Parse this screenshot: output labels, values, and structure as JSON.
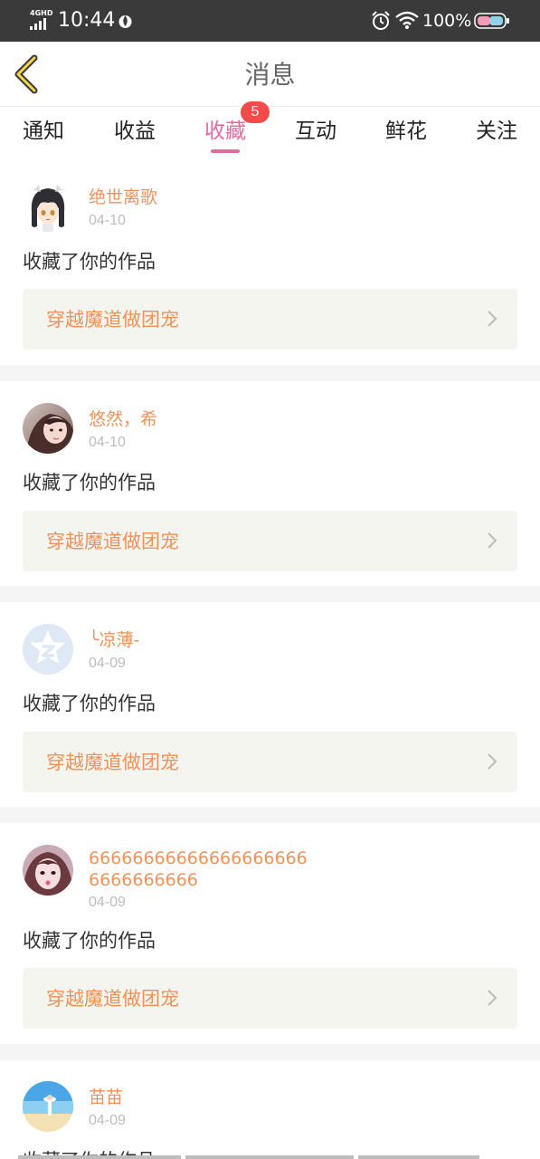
{
  "status_bar": {
    "network": "4GHD",
    "time": "10:44",
    "battery": "100%"
  },
  "header": {
    "title": "消息"
  },
  "tabs": [
    {
      "label": "通知",
      "active": false
    },
    {
      "label": "收益",
      "active": false
    },
    {
      "label": "收藏",
      "active": true,
      "badge": "5"
    },
    {
      "label": "互动",
      "active": false
    },
    {
      "label": "鲜花",
      "active": false
    },
    {
      "label": "关注",
      "active": false
    }
  ],
  "messages": [
    {
      "user": "绝世离歌",
      "date": "04-10",
      "action": "收藏了你的作品",
      "work": "穿越魔道做团宠",
      "avatar": "anime-character-avatar"
    },
    {
      "user": "悠然，希",
      "date": "04-10",
      "action": "收藏了你的作品",
      "work": "穿越魔道做团宠",
      "avatar": "girl-photo-avatar"
    },
    {
      "user": "╰凉薄-",
      "date": "04-09",
      "action": "收藏了你的作品",
      "work": "穿越魔道做团宠",
      "avatar": "default-star-avatar"
    },
    {
      "user_line1": "66666666666666666666",
      "user_line2": "6666666666",
      "date": "04-09",
      "action": "收藏了你的作品",
      "work": "穿越魔道做团宠",
      "avatar": "girl-photo-avatar"
    },
    {
      "user": "苗苗",
      "date": "04-09",
      "action": "收藏了你的作品",
      "avatar": "beach-photo-avatar"
    }
  ],
  "colors": {
    "accent": "#e56aa0",
    "username": "#f0925a",
    "badge": "#f34a4a",
    "work_box_bg": "#f5f5ef",
    "status_bar_bg": "#3a3a3a"
  }
}
